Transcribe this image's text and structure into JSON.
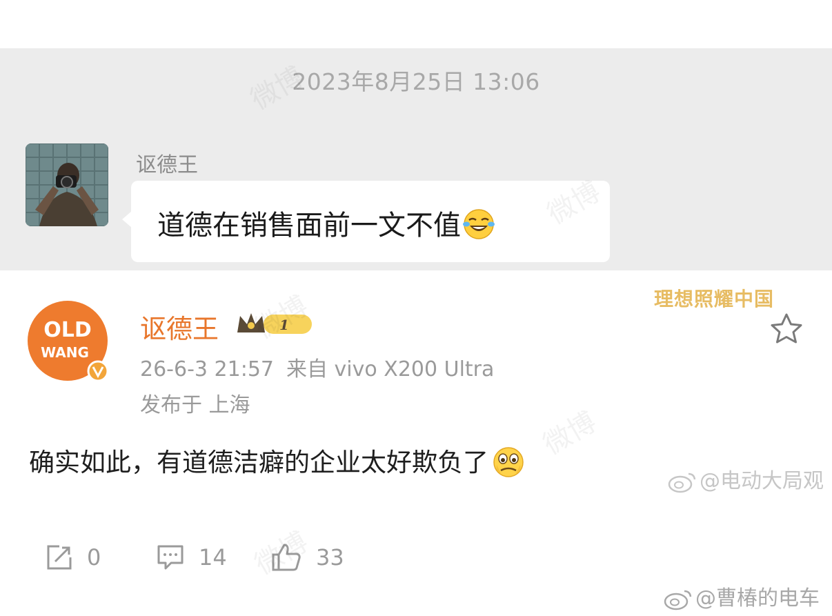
{
  "chat": {
    "timestamp": "2023年8月25日 13:06",
    "sender_name": "讴德王",
    "message": "道德在销售面前一文不值",
    "message_emoji": "laughing-tears-emoji"
  },
  "post": {
    "username": "讴德王",
    "vip_level": "1",
    "meta_time": "26-6-3 21:57",
    "meta_source": "来自 vivo X200 Ultra",
    "location": "发布于 上海",
    "body": "确实如此，有道德洁癖的企业太好欺负了",
    "body_emoji": "crying-emoji",
    "top_watermark": "理想照耀中国",
    "actions": {
      "share_count": "0",
      "comment_count": "14",
      "like_count": "33"
    }
  },
  "watermarks": {
    "middle_credit": "@电动大局观",
    "bottom_credit": "@曹椿的电车",
    "background_text": "微博"
  },
  "colors": {
    "chat_bg": "#ececec",
    "username_orange": "#e8762b",
    "muted_text": "#9a9a9a",
    "badge_gold": "#f2c94c"
  }
}
